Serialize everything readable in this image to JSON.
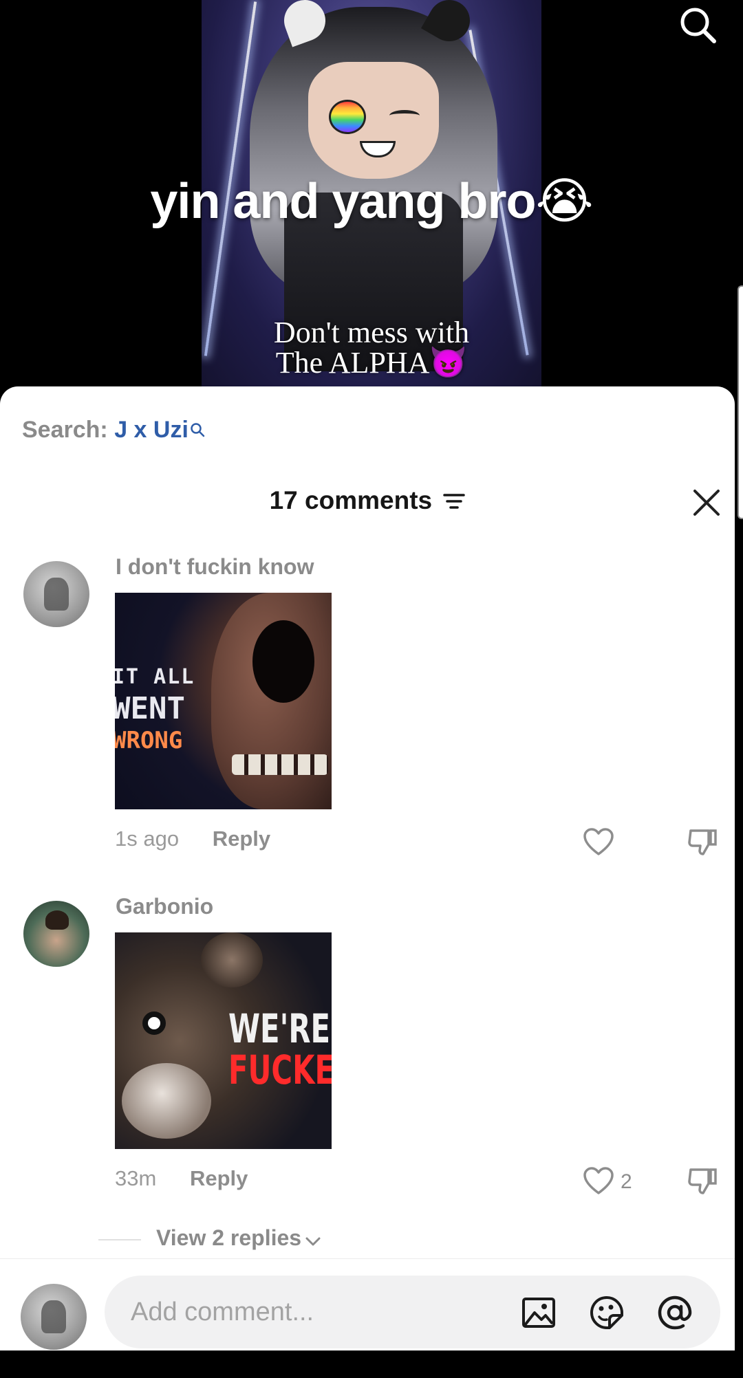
{
  "video": {
    "caption": "yin and yang bro😭",
    "overlay_line1": "Don't mess with",
    "overlay_line2": "The ALPHA😈"
  },
  "sheet": {
    "search_prefix": "Search: ",
    "search_query": "J x Uzi",
    "comment_count_label": "17 comments"
  },
  "comments": [
    {
      "username": "I don't fuckin know",
      "time": "1s ago",
      "reply_label": "Reply",
      "likes": "",
      "gif_text": [
        "IT ALL",
        "WENT",
        "WRONG"
      ]
    },
    {
      "username": "Garbonio",
      "time": "33m",
      "reply_label": "Reply",
      "likes": "2",
      "gif_text": [
        "WE'RE",
        "FUCKED"
      ],
      "view_replies_label": "View 2 replies"
    }
  ],
  "composer": {
    "placeholder": "Add comment..."
  },
  "icons": [
    "search-icon",
    "sort-icon",
    "close-icon",
    "heart-icon",
    "dislike-icon",
    "image-icon",
    "sticker-icon",
    "mention-icon",
    "chevron-down-icon"
  ],
  "colors": {
    "accent_link": "#2f5da8",
    "muted_text": "#8b8b8b"
  }
}
